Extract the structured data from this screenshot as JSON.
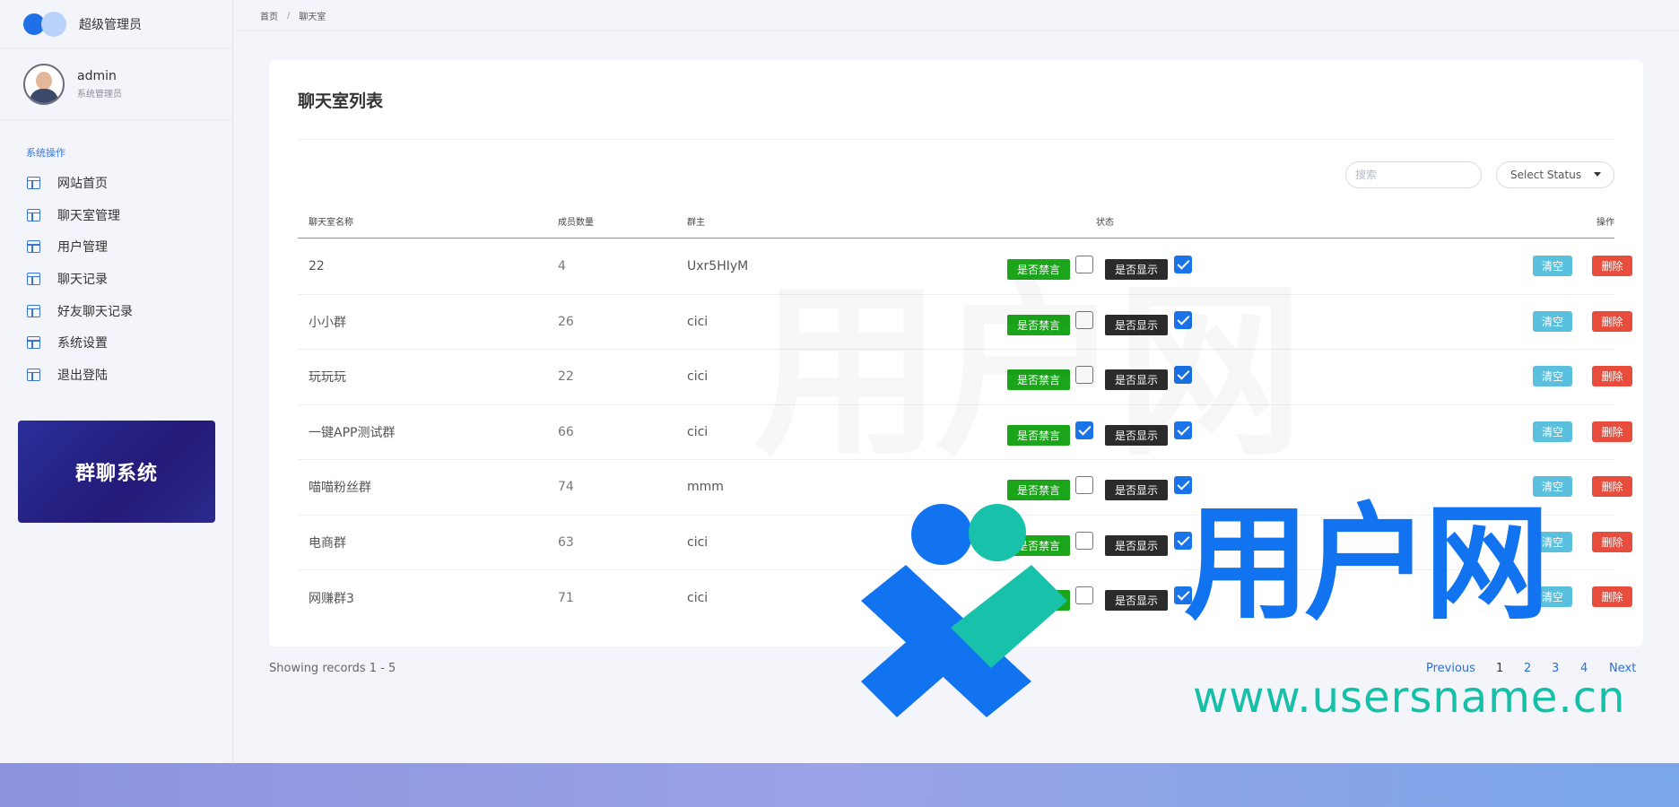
{
  "brand": {
    "title": "超级管理员"
  },
  "user": {
    "name": "admin",
    "role": "系统管理员"
  },
  "sidebar": {
    "heading": "系统操作",
    "items": [
      {
        "label": "网站首页"
      },
      {
        "label": "聊天室管理"
      },
      {
        "label": "用户管理"
      },
      {
        "label": "聊天记录"
      },
      {
        "label": "好友聊天记录"
      },
      {
        "label": "系统设置"
      },
      {
        "label": "退出登陆"
      }
    ],
    "promo": "群聊系统"
  },
  "breadcrumb": {
    "home": "首页",
    "sep": "/",
    "current": "聊天室"
  },
  "card": {
    "title": "聊天室列表",
    "search_placeholder": "搜索",
    "status_select": "Select Status"
  },
  "table": {
    "headers": {
      "name": "聊天室名称",
      "count": "成员数量",
      "owner": "群主",
      "status": "状态",
      "actions": "操作"
    },
    "rows": [
      {
        "name": "22",
        "count": "4",
        "owner": "Uxr5HIyM",
        "mute_label": "是否禁言",
        "muted": false,
        "show_label": "是否显示",
        "shown": true,
        "clear": "清空",
        "del": "删除"
      },
      {
        "name": "小小群",
        "count": "26",
        "owner": "cici",
        "mute_label": "是否禁言",
        "muted": false,
        "show_label": "是否显示",
        "shown": true,
        "clear": "清空",
        "del": "删除"
      },
      {
        "name": "玩玩玩",
        "count": "22",
        "owner": "cici",
        "mute_label": "是否禁言",
        "muted": false,
        "show_label": "是否显示",
        "shown": true,
        "clear": "清空",
        "del": "删除"
      },
      {
        "name": "一键APP测试群",
        "count": "66",
        "owner": "cici",
        "mute_label": "是否禁言",
        "muted": true,
        "show_label": "是否显示",
        "shown": true,
        "clear": "清空",
        "del": "删除"
      },
      {
        "name": "喵喵粉丝群",
        "count": "74",
        "owner": "mmm",
        "mute_label": "是否禁言",
        "muted": false,
        "show_label": "是否显示",
        "shown": true,
        "clear": "清空",
        "del": "删除"
      },
      {
        "name": "电商群",
        "count": "63",
        "owner": "cici",
        "mute_label": "是否禁言",
        "muted": false,
        "show_label": "是否显示",
        "shown": true,
        "clear": "清空",
        "del": "删除"
      },
      {
        "name": "网赚群3",
        "count": "71",
        "owner": "cici",
        "mute_label": "是否禁言",
        "muted": false,
        "show_label": "是否显示",
        "shown": true,
        "clear": "清空",
        "del": "删除"
      }
    ]
  },
  "footer": {
    "records": "Showing records 1 - 5",
    "pagination": {
      "prev": "Previous",
      "pages": [
        "1",
        "2",
        "3",
        "4"
      ],
      "next": "Next"
    }
  },
  "watermark": {
    "brand": "用户网",
    "url": "www.usersname.cn"
  },
  "colors": {
    "accent": "#1e6fe8",
    "mute_tag": "#1aa51a",
    "show_tag": "#2b2b2b",
    "clear_btn": "#5bc0de",
    "delete_btn": "#e74c3c",
    "promo_bg": "#2a2f9a"
  }
}
